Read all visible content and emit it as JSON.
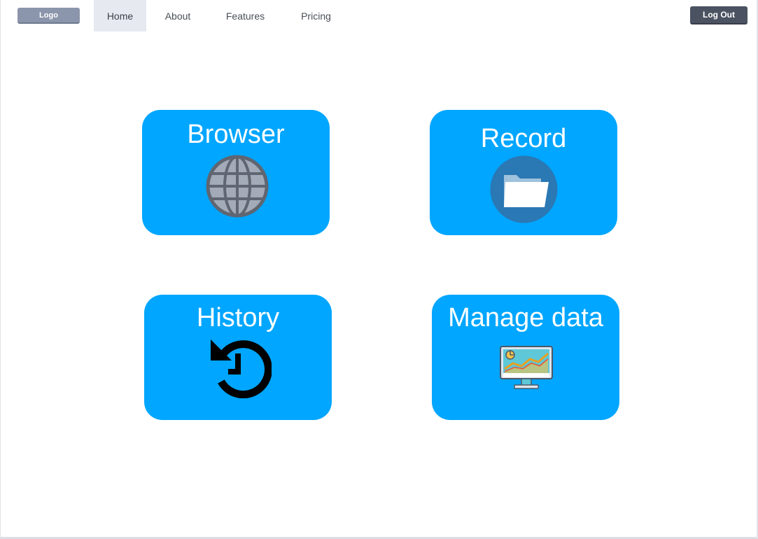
{
  "nav": {
    "logo_label": "Logo",
    "tabs": [
      {
        "label": "Home",
        "active": true
      },
      {
        "label": "About",
        "active": false
      },
      {
        "label": "Features",
        "active": false
      },
      {
        "label": "Pricing",
        "active": false
      }
    ],
    "logout_label": "Log Out"
  },
  "cards": [
    {
      "label": "Browser",
      "icon": "globe-icon"
    },
    {
      "label": "Record",
      "icon": "folder-icon"
    },
    {
      "label": "History",
      "icon": "history-icon"
    },
    {
      "label": "Manage data",
      "icon": "chart-monitor-icon"
    }
  ],
  "colors": {
    "card_bg": "#00a6ff",
    "nav_active_bg": "#e7e9f0",
    "logo_bg": "#8b95ab",
    "logout_bg": "#4b5261"
  }
}
